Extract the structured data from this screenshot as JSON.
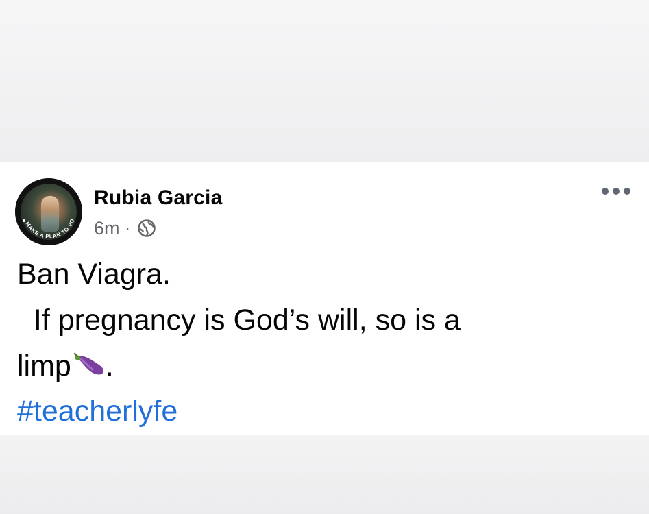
{
  "post": {
    "author": "Rubia Garcia",
    "time": "6m",
    "separator": "·",
    "privacy_icon": "globe-icon",
    "avatar_badge": "MAKE A PLAN TO VOTE",
    "more_icon": "more-horizontal-icon",
    "text_line1": "Ban Viagra.",
    "text_line2": "  If pregnancy is God’s will, so is a",
    "text_line3_word": "limp",
    "text_line3_emoji": "eggplant-icon",
    "text_line3_end": ".",
    "hashtag": "#teacherlyfe"
  },
  "colors": {
    "name": "#050505",
    "meta": "#65676b",
    "hashtag": "#216fdb",
    "eggplant": "#7b3fa0",
    "eggplant_cap": "#5c9a2e"
  }
}
